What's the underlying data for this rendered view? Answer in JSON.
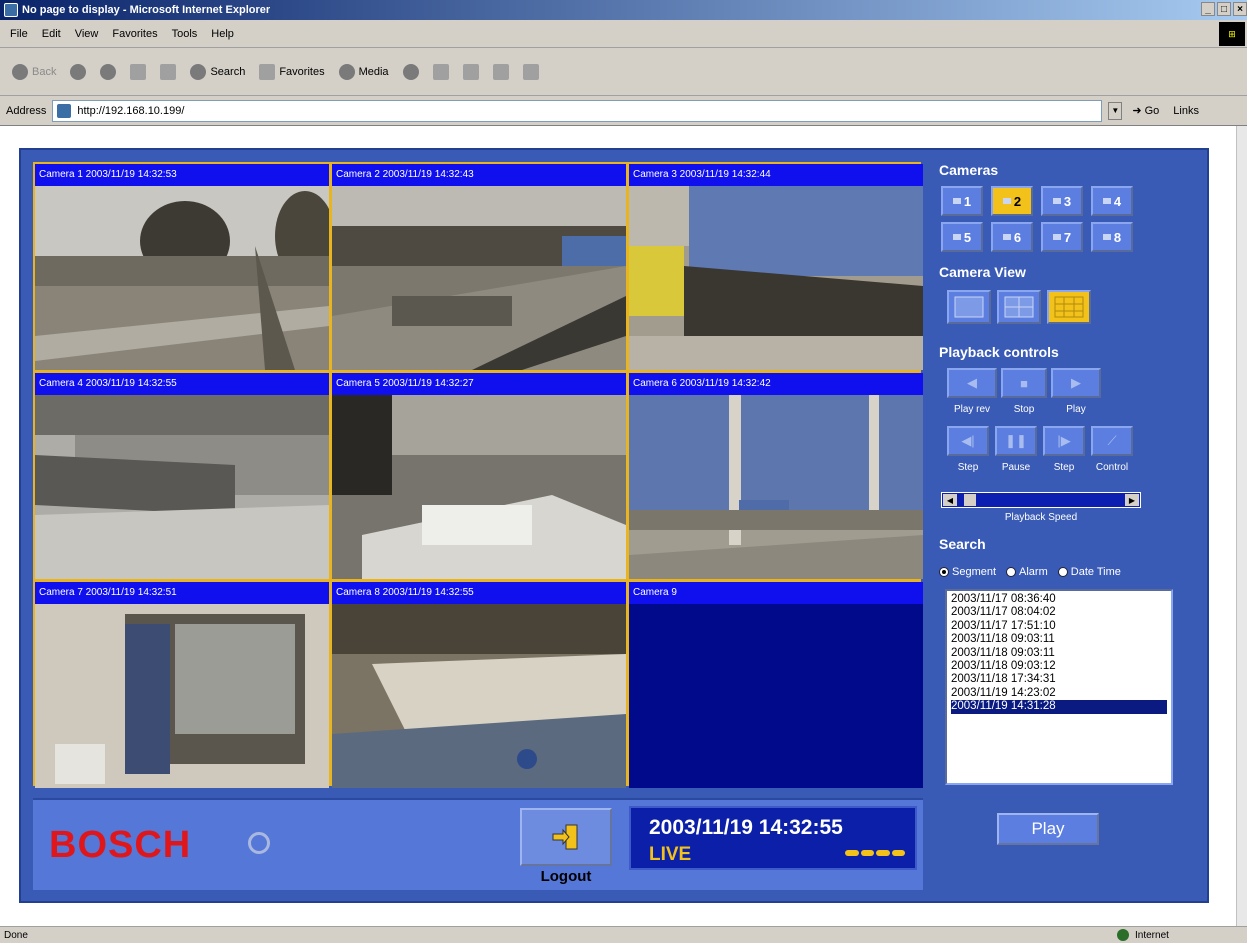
{
  "window": {
    "title": "No page to display - Microsoft Internet Explorer"
  },
  "menu": [
    "File",
    "Edit",
    "View",
    "Favorites",
    "Tools",
    "Help"
  ],
  "toolbar": {
    "back": "Back",
    "search": "Search",
    "favorites": "Favorites",
    "media": "Media"
  },
  "address": {
    "label": "Address",
    "url": "http://192.168.10.199/",
    "go": "Go",
    "links": "Links"
  },
  "status": {
    "text": "Done",
    "zone": "Internet"
  },
  "cameras": [
    {
      "label": "Camera 1 2003/11/19 14:32:53"
    },
    {
      "label": "Camera 2 2003/11/19 14:32:43"
    },
    {
      "label": "Camera 3 2003/11/19 14:32:44"
    },
    {
      "label": "Camera 4 2003/11/19 14:32:55"
    },
    {
      "label": "Camera 5 2003/11/19 14:32:27"
    },
    {
      "label": "Camera 6 2003/11/19 14:32:42"
    },
    {
      "label": "Camera 7 2003/11/19 14:32:51"
    },
    {
      "label": "Camera 8 2003/11/19 14:32:55"
    },
    {
      "label": "Camera 9"
    }
  ],
  "brand": {
    "name": "BOSCH",
    "color": "#e0171a"
  },
  "logout": {
    "label": "Logout"
  },
  "clock": {
    "datetime": "2003/11/19   14:32:55",
    "mode": "LIVE"
  },
  "side": {
    "cameras_title": "Cameras",
    "camera_buttons": [
      "1",
      "2",
      "3",
      "4",
      "5",
      "6",
      "7",
      "8"
    ],
    "active_camera": "2",
    "view_title": "Camera View",
    "playback_title": "Playback controls",
    "playback_labels": [
      "Play rev",
      "Stop",
      "Play"
    ],
    "step_labels": [
      "Step",
      "Pause",
      "Step",
      "Control"
    ],
    "speed_label": "Playback Speed",
    "search_title": "Search",
    "search_options": [
      "Segment",
      "Alarm",
      "Date Time"
    ],
    "selected_search": "Segment",
    "segments": [
      "2003/11/17 08:36:40",
      "2003/11/17 08:04:02",
      "2003/11/17 17:51:10",
      "2003/11/18 09:03:11",
      "2003/11/18 09:03:11",
      "2003/11/18 09:03:12",
      "2003/11/18 17:34:31",
      "2003/11/19 14:23:02",
      "2003/11/19 14:31:28"
    ],
    "selected_segment": "2003/11/19 14:31:28",
    "play_button": "Play"
  }
}
